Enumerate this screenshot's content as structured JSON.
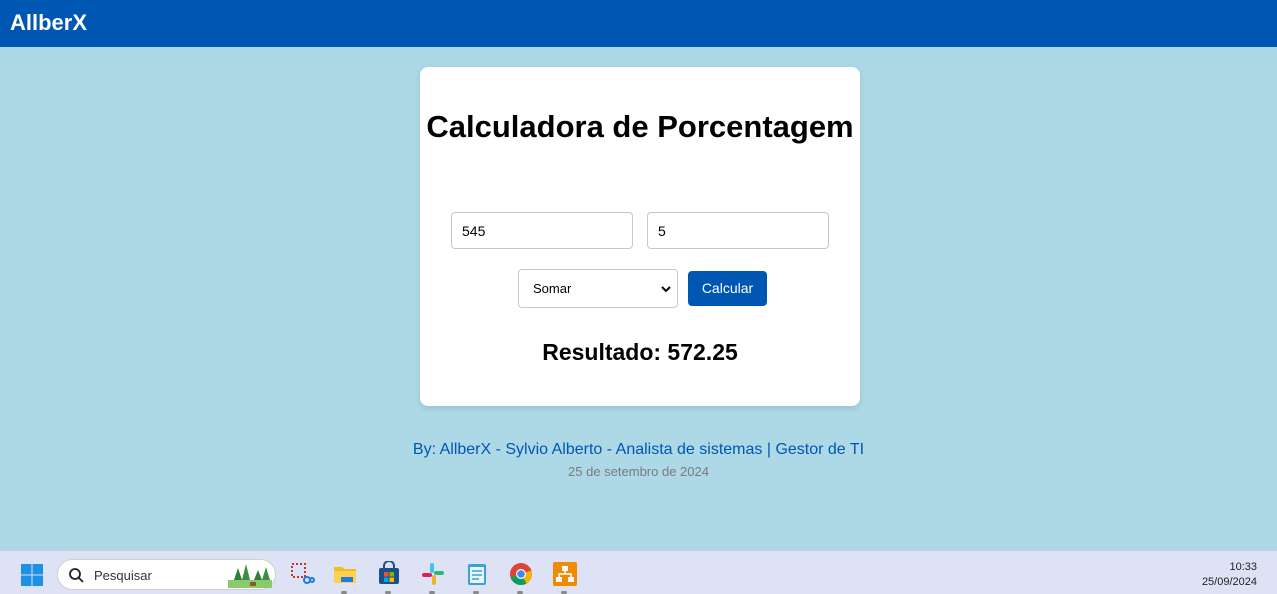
{
  "header": {
    "brand": "AllberX"
  },
  "calculator": {
    "title": "Calculadora de Porcentagem",
    "input1_value": "545",
    "input2_value": "5",
    "operation_selected": "Somar",
    "calculate_label": "Calcular",
    "result_text": "Resultado: 572.25"
  },
  "footer": {
    "credit": "By: AllberX - Sylvio Alberto - Analista de sistemas | Gestor de TI",
    "date": "25 de setembro de 2024"
  },
  "taskbar": {
    "search_placeholder": "Pesquisar",
    "apps": [
      "snipping-tool-icon",
      "file-explorer-icon",
      "microsoft-store-icon",
      "slack-icon",
      "notepad-icon",
      "chrome-icon",
      "network-app-icon"
    ],
    "time": "10:33",
    "date": "25/09/2024"
  },
  "colors": {
    "page_background": "#add8e6",
    "header_background": "#0056b3",
    "button_background": "#0056b3",
    "card_background": "#ffffff",
    "footer_credit": "#0056b3"
  }
}
